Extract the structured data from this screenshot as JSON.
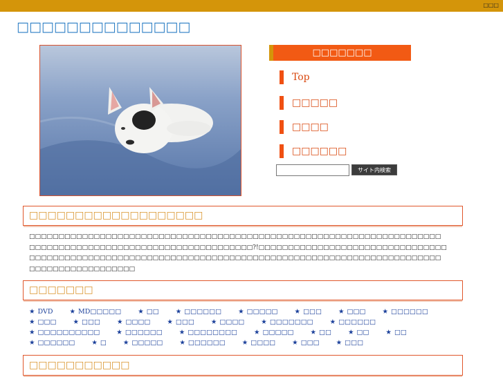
{
  "topbar": {
    "right_label": "□□□"
  },
  "header": {
    "site_title": "□□□□□□□□□□□□□□"
  },
  "menu": {
    "heading": "□□□□□□□",
    "items": [
      "Top",
      "□□□□□",
      "□□□□",
      "□□□□□□"
    ]
  },
  "search": {
    "input_value": "",
    "button_label": "サイト内検索"
  },
  "sections": [
    {
      "title": "□□□□□□□□□□□□□□□□□□□"
    },
    {
      "title": "□□□□□□□"
    },
    {
      "title": "□□□□□□□□□□□"
    }
  ],
  "article": {
    "lines": [
      "□□□□□□□□□□□□□□□□□□□□□□□□□□□□□□□□□□□□□□□□□□□□□□□□□□□□□□□□□□□□□□□□□□□□□□",
      "□□□□□□□□□□□□□□□□□□□□□□□□□□□□□□□□□□□□□□?!□□□□□□□□□□□□□□□□□□□□□□□□□□□□□□□□",
      "□□□□□□□□□□□□□□□□□□□□□□□□□□□□□□□□□□□□□□□□□□□□□□□□□□□□□□□□□□□□□□□□□□□□□□",
      "□□□□□□□□□□□□□□□□□□"
    ]
  },
  "tags": [
    "DVD",
    "MD□□□□□",
    "□□",
    "□□□□□□",
    "□□□□□",
    "□□□",
    "□□□",
    "□□□□□□",
    "□□□",
    "□□□",
    "□□□□",
    "□□□",
    "□□□□",
    "□□□□□□□",
    "□□□□□□",
    "□□□□□□□□□□",
    "□□□□□□",
    "□□□□□□□□",
    "□□□□□",
    "□□",
    "□□",
    "□□",
    "□□□□□□",
    "□",
    "□□□□□",
    "□□□□□□",
    "□□□□",
    "□□□",
    "□□□"
  ],
  "colors": {
    "accent_orange": "#f25a14",
    "gold": "#d4950a",
    "title_blue": "#2a7dc4",
    "link_blue": "#1a3f9a"
  },
  "icons": {
    "tag_bullet": "star-icon"
  }
}
